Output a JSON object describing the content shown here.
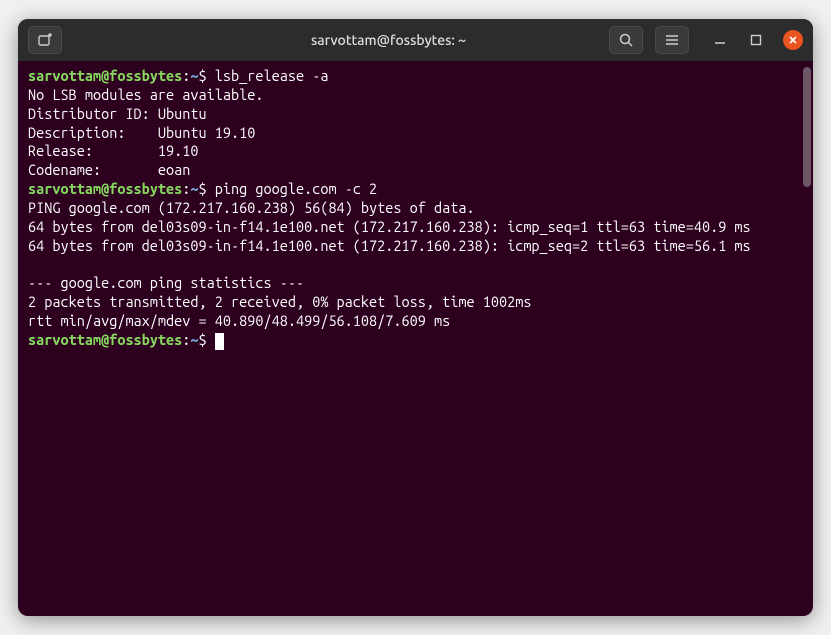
{
  "titlebar": {
    "title": "sarvottam@fossbytes: ~"
  },
  "prompt": {
    "user_host": "sarvottam@fossbytes",
    "separator": ":",
    "path": "~",
    "symbol": "$"
  },
  "session": [
    {
      "type": "prompt",
      "command": "lsb_release -a"
    },
    {
      "type": "output",
      "text": "No LSB modules are available."
    },
    {
      "type": "output",
      "text": "Distributor ID: Ubuntu"
    },
    {
      "type": "output",
      "text": "Description:    Ubuntu 19.10"
    },
    {
      "type": "output",
      "text": "Release:        19.10"
    },
    {
      "type": "output",
      "text": "Codename:       eoan"
    },
    {
      "type": "prompt",
      "command": "ping google.com -c 2"
    },
    {
      "type": "output",
      "text": "PING google.com (172.217.160.238) 56(84) bytes of data."
    },
    {
      "type": "output",
      "text": "64 bytes from del03s09-in-f14.1e100.net (172.217.160.238): icmp_seq=1 ttl=63 time=40.9 ms"
    },
    {
      "type": "output",
      "text": "64 bytes from del03s09-in-f14.1e100.net (172.217.160.238): icmp_seq=2 ttl=63 time=56.1 ms"
    },
    {
      "type": "output",
      "text": ""
    },
    {
      "type": "output",
      "text": "--- google.com ping statistics ---"
    },
    {
      "type": "output",
      "text": "2 packets transmitted, 2 received, 0% packet loss, time 1002ms"
    },
    {
      "type": "output",
      "text": "rtt min/avg/max/mdev = 40.890/48.499/56.108/7.609 ms"
    },
    {
      "type": "prompt",
      "command": ""
    }
  ]
}
